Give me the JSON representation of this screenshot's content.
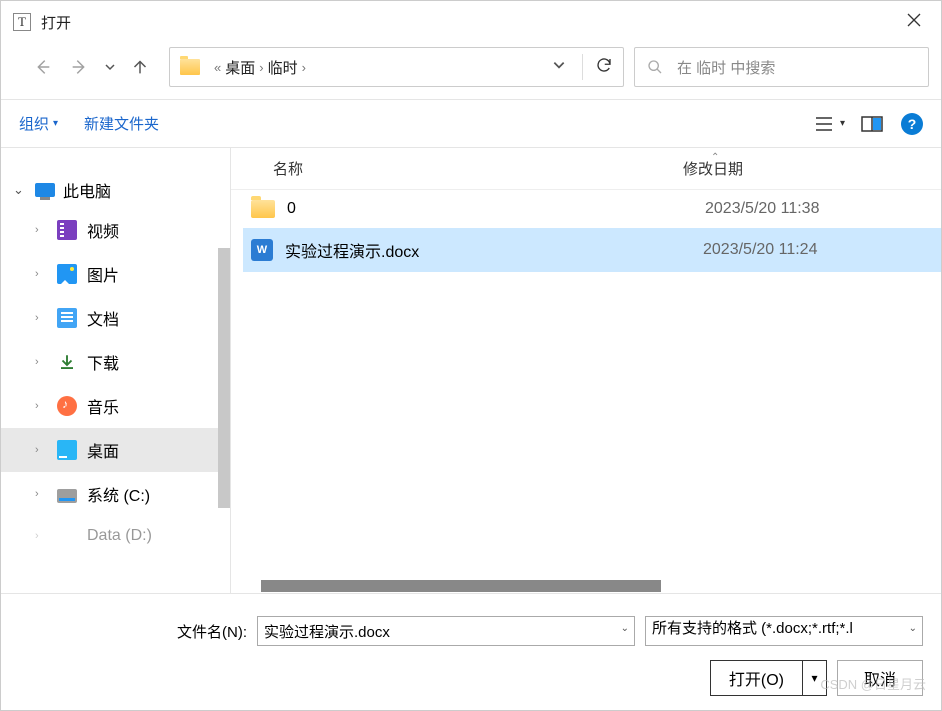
{
  "title": "打开",
  "app_icon_letter": "T",
  "breadcrumb": {
    "items": [
      "桌面",
      "临时"
    ],
    "prefix": "«"
  },
  "search": {
    "placeholder": "在 临时 中搜索"
  },
  "toolbar": {
    "organize": "组织",
    "new_folder": "新建文件夹"
  },
  "sidebar": {
    "root": "此电脑",
    "items": [
      {
        "label": "视频"
      },
      {
        "label": "图片"
      },
      {
        "label": "文档"
      },
      {
        "label": "下载"
      },
      {
        "label": "音乐"
      },
      {
        "label": "桌面",
        "selected": true
      },
      {
        "label": "系统 (C:)"
      },
      {
        "label": "Data (D:)"
      }
    ]
  },
  "columns": {
    "name": "名称",
    "date": "修改日期"
  },
  "files": [
    {
      "name": "0",
      "date": "2023/5/20 11:38",
      "type": "folder",
      "selected": false
    },
    {
      "name": "实验过程演示.docx",
      "date": "2023/5/20 11:24",
      "type": "docx",
      "selected": true
    }
  ],
  "footer": {
    "filename_label": "文件名(N):",
    "filename_value": "实验过程演示.docx",
    "filter_value": "所有支持的格式 (*.docx;*.rtf;*.l",
    "open_label": "打开(O)",
    "cancel_label": "取消"
  },
  "watermark": "CSDN @日星月云"
}
